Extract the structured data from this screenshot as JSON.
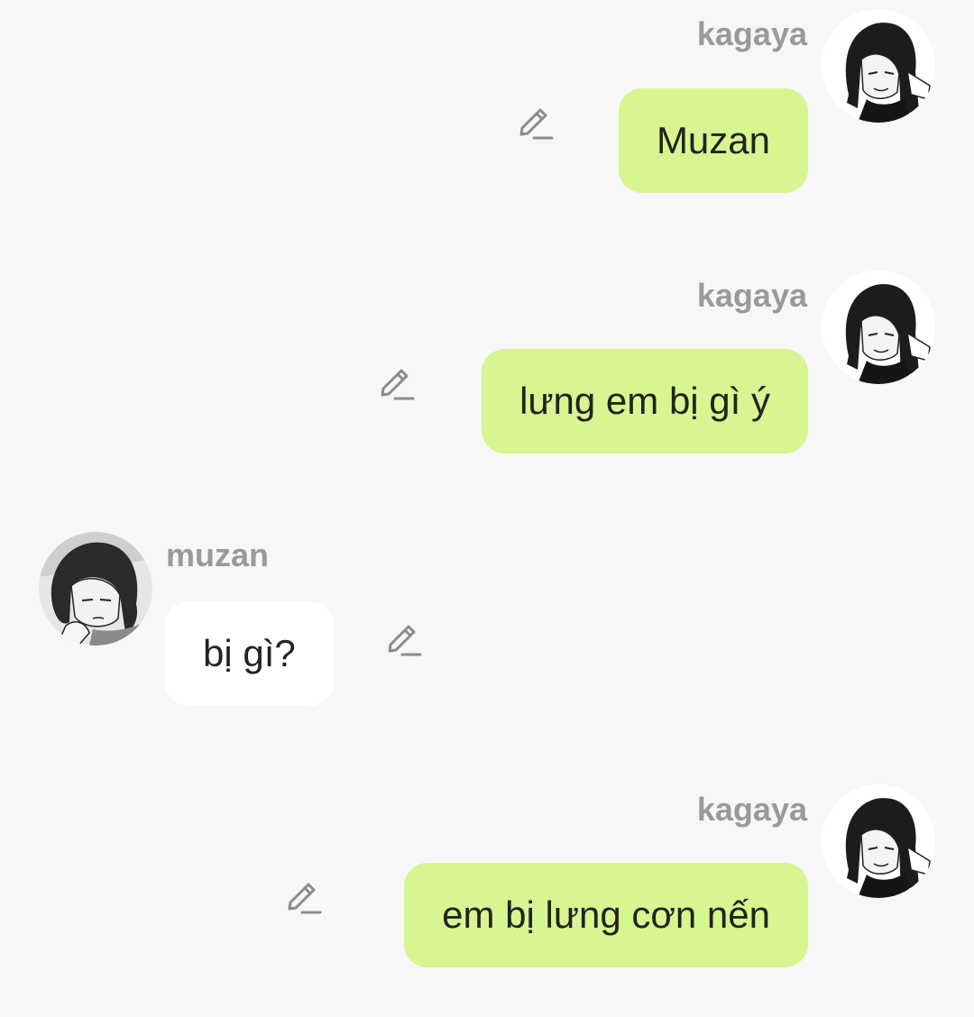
{
  "colors": {
    "background": "#f7f7f7",
    "outgoing_bubble": "#d7f590",
    "incoming_bubble": "#ffffff",
    "sender_name": "#9a9a9a",
    "message_text": "#222222"
  },
  "messages": [
    {
      "direction": "outgoing",
      "sender": "kagaya",
      "text": "Muzan",
      "avatar_icon": "kagaya-avatar",
      "edit_icon": "pencil-icon"
    },
    {
      "direction": "outgoing",
      "sender": "kagaya",
      "text": "lưng em bị gì ý",
      "avatar_icon": "kagaya-avatar",
      "edit_icon": "pencil-icon"
    },
    {
      "direction": "incoming",
      "sender": "muzan",
      "text": "bị gì?",
      "avatar_icon": "muzan-avatar",
      "edit_icon": "pencil-icon"
    },
    {
      "direction": "outgoing",
      "sender": "kagaya",
      "text": "em bị lưng cơn nến",
      "avatar_icon": "kagaya-avatar",
      "edit_icon": "pencil-icon"
    }
  ]
}
